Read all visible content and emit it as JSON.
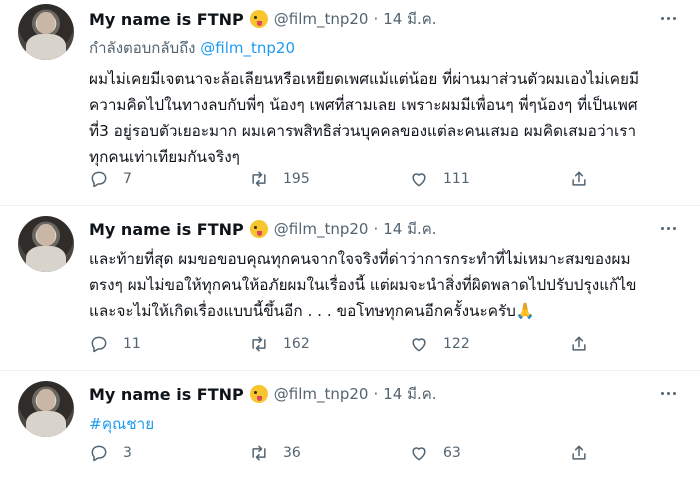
{
  "tweets": [
    {
      "name": "My name is FTNP",
      "handle": "@film_tnp20",
      "sep": "·",
      "date": "14 มี.ค.",
      "reply_prefix": "กำลังตอบกลับถึง",
      "reply_handle": "@film_tnp20",
      "text": "ผมไม่เคยมีเจตนาจะล้อเลียนหรือเหยียดเพศแม้แต่น้อย ที่ผ่านมาส่วนตัวผมเองไม่เคยมีความคิดไปในทางลบกับพี่ๆ น้องๆ เพศที่สามเลย เพราะผมมีเพื่อนๆ พี่ๆน้องๆ ที่เป็นเพศที่3 อยู่รอบตัวเยอะมาก ผมเคารพสิทธิส่วนบุคคลของแต่ละคนเสมอ ผมคิดเสมอว่าเราทุกคนเท่าเทียมกันจริงๆ",
      "replies": "7",
      "retweets": "195",
      "likes": "111"
    },
    {
      "name": "My name is FTNP",
      "handle": "@film_tnp20",
      "sep": "·",
      "date": "14 มี.ค.",
      "text": "และท้ายที่สุด ผมขอขอบคุณทุกคนจากใจจริงที่ด่าว่าการกระทำที่ไม่เหมาะสมของผมตรงๆ ผมไม่ขอให้ทุกคนให้อภัยผมในเรื่องนี้ แต่ผมจะนำสิ่งที่ผิดพลาดไปปรับปรุงแก้ไขและจะไม่ให้เกิดเรื่องแบบนี้ขึ้นอีก . . . ขอโทษทุกคนอีกครั้งนะครับ🙏",
      "replies": "11",
      "retweets": "162",
      "likes": "122"
    },
    {
      "name": "My name is FTNP",
      "handle": "@film_tnp20",
      "sep": "·",
      "date": "14 มี.ค.",
      "text": "#คุณชาย",
      "replies": "3",
      "retweets": "36",
      "likes": "63"
    }
  ],
  "icons": {
    "emoji": "winking-tongue-emoji-icon",
    "more": "more-horizontal-icon",
    "reply": "reply-icon",
    "retweet": "retweet-icon",
    "like": "heart-icon",
    "share": "share-icon"
  },
  "colors": {
    "link": "#1d9bf0",
    "muted": "#536471",
    "text": "#0f1419"
  }
}
